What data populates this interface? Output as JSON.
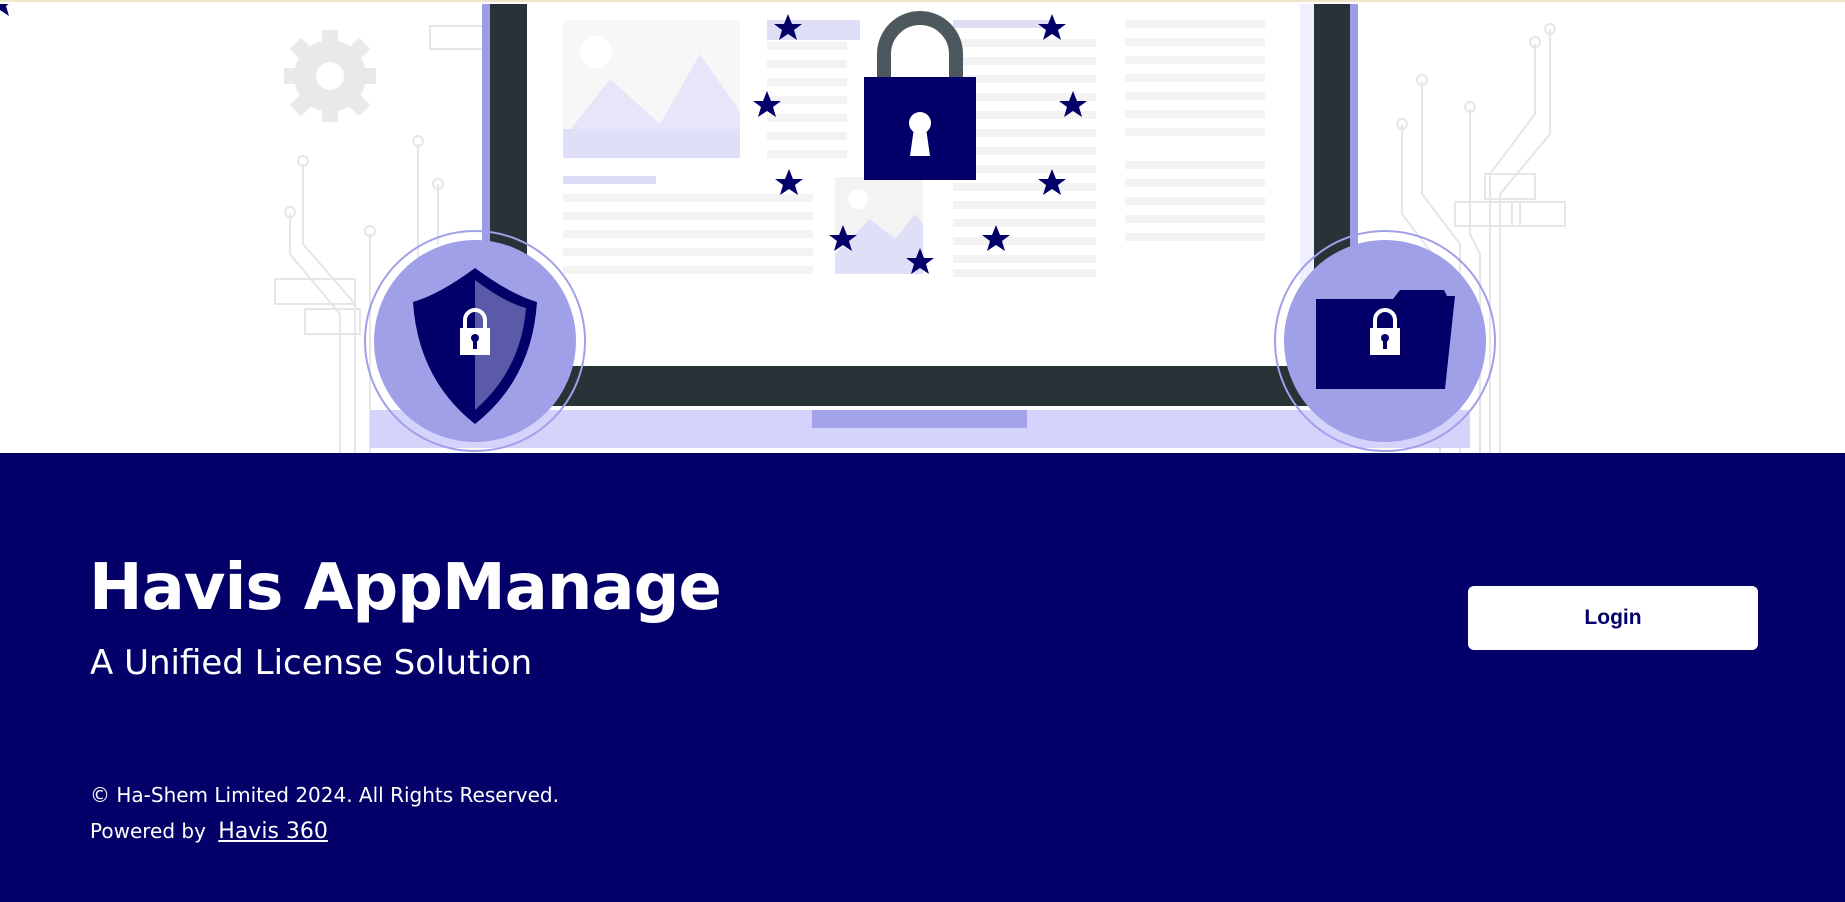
{
  "app": {
    "title": "Havis AppManage",
    "subtitle": "A Unified License Solution"
  },
  "actions": {
    "login_label": "Login"
  },
  "footer": {
    "copyright": "© Ha-Shem Limited 2024. All Rights Reserved.",
    "powered_by_label": "Powered by",
    "powered_by_link": "Havis 360"
  },
  "colors": {
    "brand_navy": "#030069",
    "accent_lavender": "#a0a0e8",
    "laptop_frame": "#283237",
    "background": "#ffffff"
  },
  "icons": [
    "gear-icon",
    "padlock-icon",
    "shield-lock-icon",
    "folder-lock-icon",
    "star-icon",
    "image-placeholder-icon"
  ]
}
